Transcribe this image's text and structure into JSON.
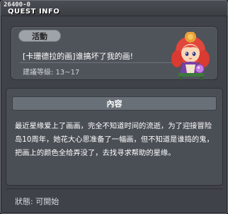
{
  "header": {
    "quest_id": "26400-0",
    "title": "QUEST INFO"
  },
  "quest": {
    "category": "活動",
    "title": "[卡珊德拉的画]谁搞坏了我的画!",
    "level_requirement": "建議等級: 13~17"
  },
  "content": {
    "header": "內容",
    "body": "最近星缘爱上了画画，完全不知道时间的流逝，为了迎接冒险岛10周年，她花大心思准备了一幅画，但不知道是谁捣的鬼，把画上的颜色全给弄没了，去找寻求帮助的星缘。"
  },
  "footer": {
    "status": "狀態:  可開始"
  },
  "avatar": {
    "icon": "npc-character-icon"
  }
}
